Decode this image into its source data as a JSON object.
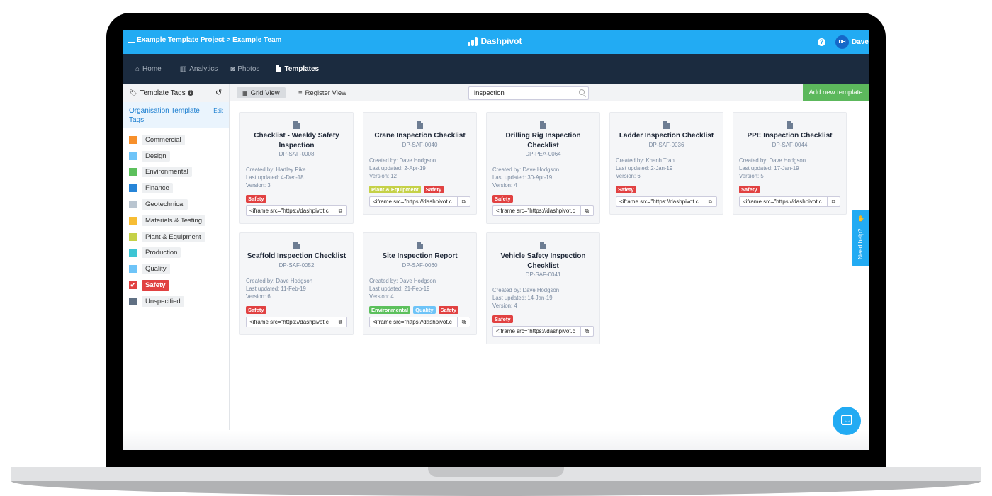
{
  "topbar": {
    "breadcrumb": "Example Template Project > Example Team",
    "brand": "Dashpivot",
    "help": "?",
    "avatar_initials": "DH",
    "user_name": "Dave"
  },
  "nav": {
    "items": [
      {
        "label": "Home",
        "icon": "home-icon"
      },
      {
        "label": "Analytics",
        "icon": "bar-chart-icon"
      },
      {
        "label": "Photos",
        "icon": "camera-icon"
      },
      {
        "label": "Templates",
        "icon": "document-icon",
        "active": true
      }
    ]
  },
  "sidebar": {
    "header": "Template Tags",
    "org_title": "Organisation Template Tags",
    "edit_label": "Edit",
    "tags": [
      {
        "label": "Commercial",
        "color": "#f7902b"
      },
      {
        "label": "Design",
        "color": "#6ec4f8"
      },
      {
        "label": "Environmental",
        "color": "#5cc05c"
      },
      {
        "label": "Finance",
        "color": "#2685d8"
      },
      {
        "label": "Geotechnical",
        "color": "#b9c5d0"
      },
      {
        "label": "Materials & Testing",
        "color": "#f7bd34"
      },
      {
        "label": "Plant & Equipment",
        "color": "#c5d147"
      },
      {
        "label": "Production",
        "color": "#3cc5d4"
      },
      {
        "label": "Quality",
        "color": "#6ec4f8"
      },
      {
        "label": "Safety",
        "color": "#e14141",
        "checked": true
      },
      {
        "label": "Unspecified",
        "color": "#607083"
      }
    ]
  },
  "toolbar": {
    "grid_view": "Grid View",
    "register_view": "Register View",
    "search_value": "inspection",
    "add_button": "Add new template"
  },
  "tag_colors": {
    "Safety": "#e14141",
    "Plant & Equipment": "#c5d147",
    "Environmental": "#5cc05c",
    "Quality": "#6ec4f8"
  },
  "cards": [
    {
      "title": "Checklist - Weekly Safety Inspection",
      "code": "DP-SAF-0008",
      "created_by": "Created by: Hartley Pike",
      "updated": "Last updated: 4-Dec-18",
      "version": "Version: 3",
      "tags": [
        "Safety"
      ],
      "embed": "<iframe src=\"https://dashpivot.c"
    },
    {
      "title": "Crane Inspection Checklist",
      "code": "DP-SAF-0040",
      "created_by": "Created by: Dave Hodgson",
      "updated": "Last updated: 2-Apr-19",
      "version": "Version: 12",
      "tags": [
        "Plant & Equipment",
        "Safety"
      ],
      "embed": "<iframe src=\"https://dashpivot.c"
    },
    {
      "title": "Drilling Rig Inspection Checklist",
      "code": "DP-PEA-0064",
      "created_by": "Created by: Dave Hodgson",
      "updated": "Last updated: 30-Apr-19",
      "version": "Version: 4",
      "tags": [
        "Safety"
      ],
      "embed": "<iframe src=\"https://dashpivot.c"
    },
    {
      "title": "Ladder Inspection Checklist",
      "code": "DP-SAF-0036",
      "created_by": "Created by: Khanh Tran",
      "updated": "Last updated: 2-Jan-19",
      "version": "Version: 6",
      "tags": [
        "Safety"
      ],
      "embed": "<iframe src=\"https://dashpivot.c"
    },
    {
      "title": "PPE Inspection Checklist",
      "code": "DP-SAF-0044",
      "created_by": "Created by: Dave Hodgson",
      "updated": "Last updated: 17-Jan-19",
      "version": "Version: 5",
      "tags": [
        "Safety"
      ],
      "embed": "<iframe src=\"https://dashpivot.c"
    },
    {
      "title": "Scaffold Inspection Checklist",
      "code": "DP-SAF-0052",
      "created_by": "Created by: Dave Hodgson",
      "updated": "Last updated: 11-Feb-19",
      "version": "Version: 6",
      "tags": [
        "Safety"
      ],
      "embed": "<iframe src=\"https://dashpivot.c"
    },
    {
      "title": "Site Inspection Report",
      "code": "DP-SAF-0060",
      "created_by": "Created by: Dave Hodgson",
      "updated": "Last updated: 21-Feb-19",
      "version": "Version: 4",
      "tags": [
        "Environmental",
        "Quality",
        "Safety"
      ],
      "embed": "<iframe src=\"https://dashpivot.c"
    },
    {
      "title": "Vehicle Safety Inspection Checklist",
      "code": "DP-SAF-0041",
      "created_by": "Created by: Dave Hodgson",
      "updated": "Last updated: 14-Jan-19",
      "version": "Version: 4",
      "tags": [
        "Safety"
      ],
      "embed": "<iframe src=\"https://dashpivot.c"
    }
  ],
  "widgets": {
    "need_help": "Need help?"
  }
}
